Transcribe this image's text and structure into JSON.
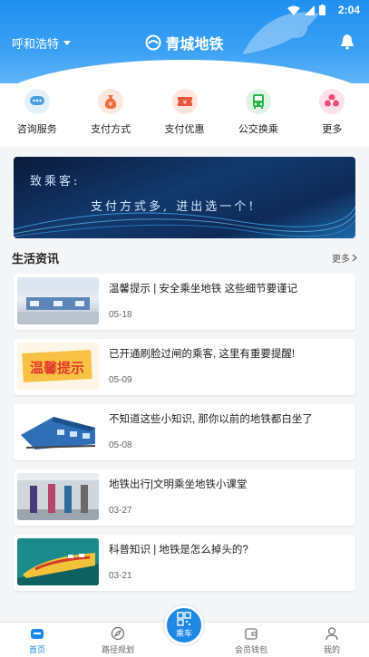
{
  "status_bar": {
    "time": "2:04"
  },
  "header": {
    "city": "呼和浩特",
    "title": "青城地铁"
  },
  "quick_menu": [
    {
      "label": "咨询服务",
      "icon": "chat-icon",
      "color": "#4a9fe0"
    },
    {
      "label": "支付方式",
      "icon": "money-bag-icon",
      "color": "#ef6c3e"
    },
    {
      "label": "支付优惠",
      "icon": "coupon-icon",
      "color": "#e9563d"
    },
    {
      "label": "公交换乘",
      "icon": "bus-icon",
      "color": "#2bb24c"
    },
    {
      "label": "更多",
      "icon": "more-icon",
      "color": "#f04a78"
    }
  ],
  "banner": {
    "line1": "致乘客:",
    "line2": "支付方式多, 进出选一个!"
  },
  "news_section": {
    "title": "生活资讯",
    "more": "更多"
  },
  "news": [
    {
      "title": "温馨提示 | 安全乘坐地铁 这些细节要谨记",
      "date": "05-18",
      "thumb": "station-gates"
    },
    {
      "title": "已开通刷脸过闸的乘客, 这里有重要提醒!",
      "date": "05-09",
      "thumb": "warm-tip",
      "thumb_text": "温馨提示"
    },
    {
      "title": "不知道这些小知识, 那你以前的地铁都白坐了",
      "date": "05-08",
      "thumb": "train-illustration"
    },
    {
      "title": "地铁出行|文明乘坐地铁小课堂",
      "date": "03-27",
      "thumb": "carriage"
    },
    {
      "title": "科普知识 | 地铁是怎么掉头的?",
      "date": "03-21",
      "thumb": "speed-train"
    }
  ],
  "tabbar": {
    "home": "首页",
    "route": "路径规划",
    "ride": "乘车",
    "wallet": "会员钱包",
    "mine": "我的"
  },
  "colors": {
    "primary": "#1e88e5",
    "header_top": "#1f8ff0"
  }
}
